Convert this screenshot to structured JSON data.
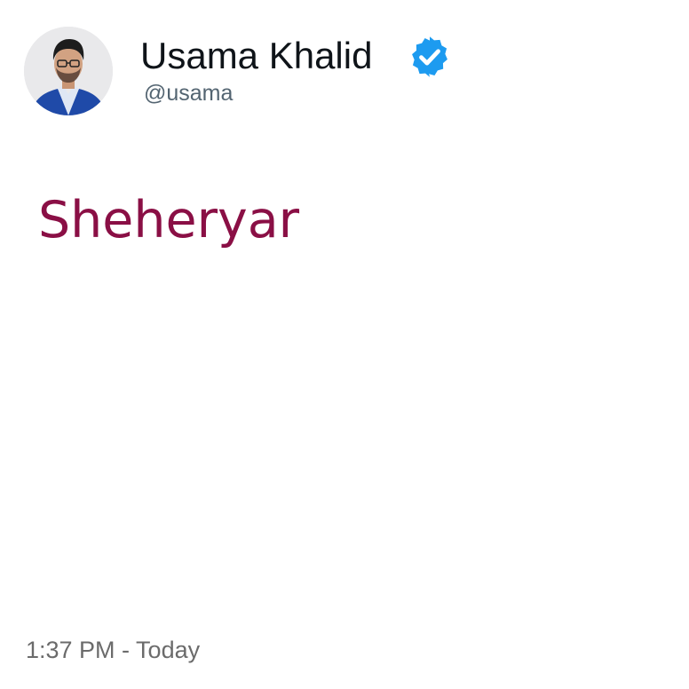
{
  "profile": {
    "display_name": "Usama Khalid",
    "handle": "@usama",
    "verified": true,
    "avatar_icon": "profile-photo-avatar"
  },
  "tweet": {
    "text": "Sheheryar",
    "timestamp": "1:37 PM - Today"
  },
  "colors": {
    "name": "#0f1419",
    "handle": "#536471",
    "verified_badge": "#1d9bf0",
    "tweet_text": "#8a0f45",
    "timestamp": "#6b6b6b"
  }
}
